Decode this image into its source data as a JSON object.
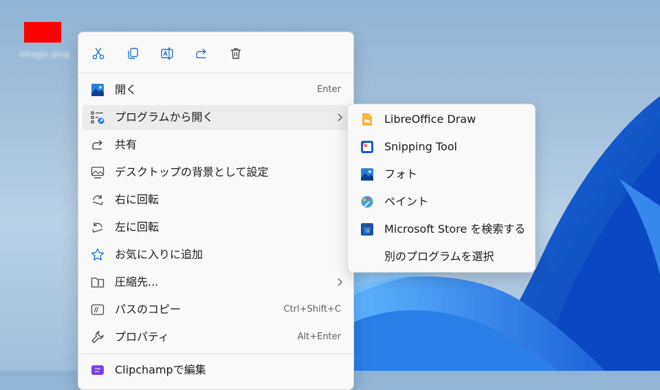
{
  "desktop": {
    "icon_label": "Image.png"
  },
  "colors": {
    "accent": "#1f6fd1",
    "menu_bg": "#f9f9f9",
    "highlight": "#ececec",
    "thumb": "#ff0000"
  },
  "toolbar": {
    "icons": [
      "cut-icon",
      "copy-icon",
      "rename-icon",
      "share-icon",
      "delete-icon"
    ]
  },
  "menu": {
    "items": [
      {
        "label": "開く",
        "shortcut": "Enter",
        "icon": "photo-icon"
      },
      {
        "label": "プログラムから開く",
        "shortcut": "",
        "icon": "open-with-icon",
        "has_submenu": true
      },
      {
        "label": "共有",
        "shortcut": "",
        "icon": "share-icon"
      },
      {
        "label": "デスクトップの背景として設定",
        "shortcut": "",
        "icon": "desktop-background-icon"
      },
      {
        "label": "右に回転",
        "shortcut": "",
        "icon": "rotate-right-icon"
      },
      {
        "label": "左に回転",
        "shortcut": "",
        "icon": "rotate-left-icon"
      },
      {
        "label": "お気に入りに追加",
        "shortcut": "",
        "icon": "star-icon"
      },
      {
        "label": "圧縮先...",
        "shortcut": "",
        "icon": "zip-folder-icon",
        "has_submenu": true
      },
      {
        "label": "パスのコピー",
        "shortcut": "Ctrl+Shift+C",
        "icon": "copy-path-icon"
      },
      {
        "label": "プロパティ",
        "shortcut": "Alt+Enter",
        "icon": "wrench-icon"
      },
      {
        "label": "Clipchampで編集",
        "shortcut": "",
        "icon": "clipchamp-icon"
      }
    ]
  },
  "submenu": {
    "items": [
      {
        "label": "LibreOffice Draw",
        "icon": "libreoffice-draw-icon"
      },
      {
        "label": "Snipping Tool",
        "icon": "snipping-tool-icon"
      },
      {
        "label": "フォト",
        "icon": "photos-icon"
      },
      {
        "label": "ペイント",
        "icon": "paint-icon"
      },
      {
        "label": "Microsoft Store を検索する",
        "icon": "store-icon"
      },
      {
        "label": "別のプログラムを選択",
        "icon": ""
      }
    ]
  }
}
